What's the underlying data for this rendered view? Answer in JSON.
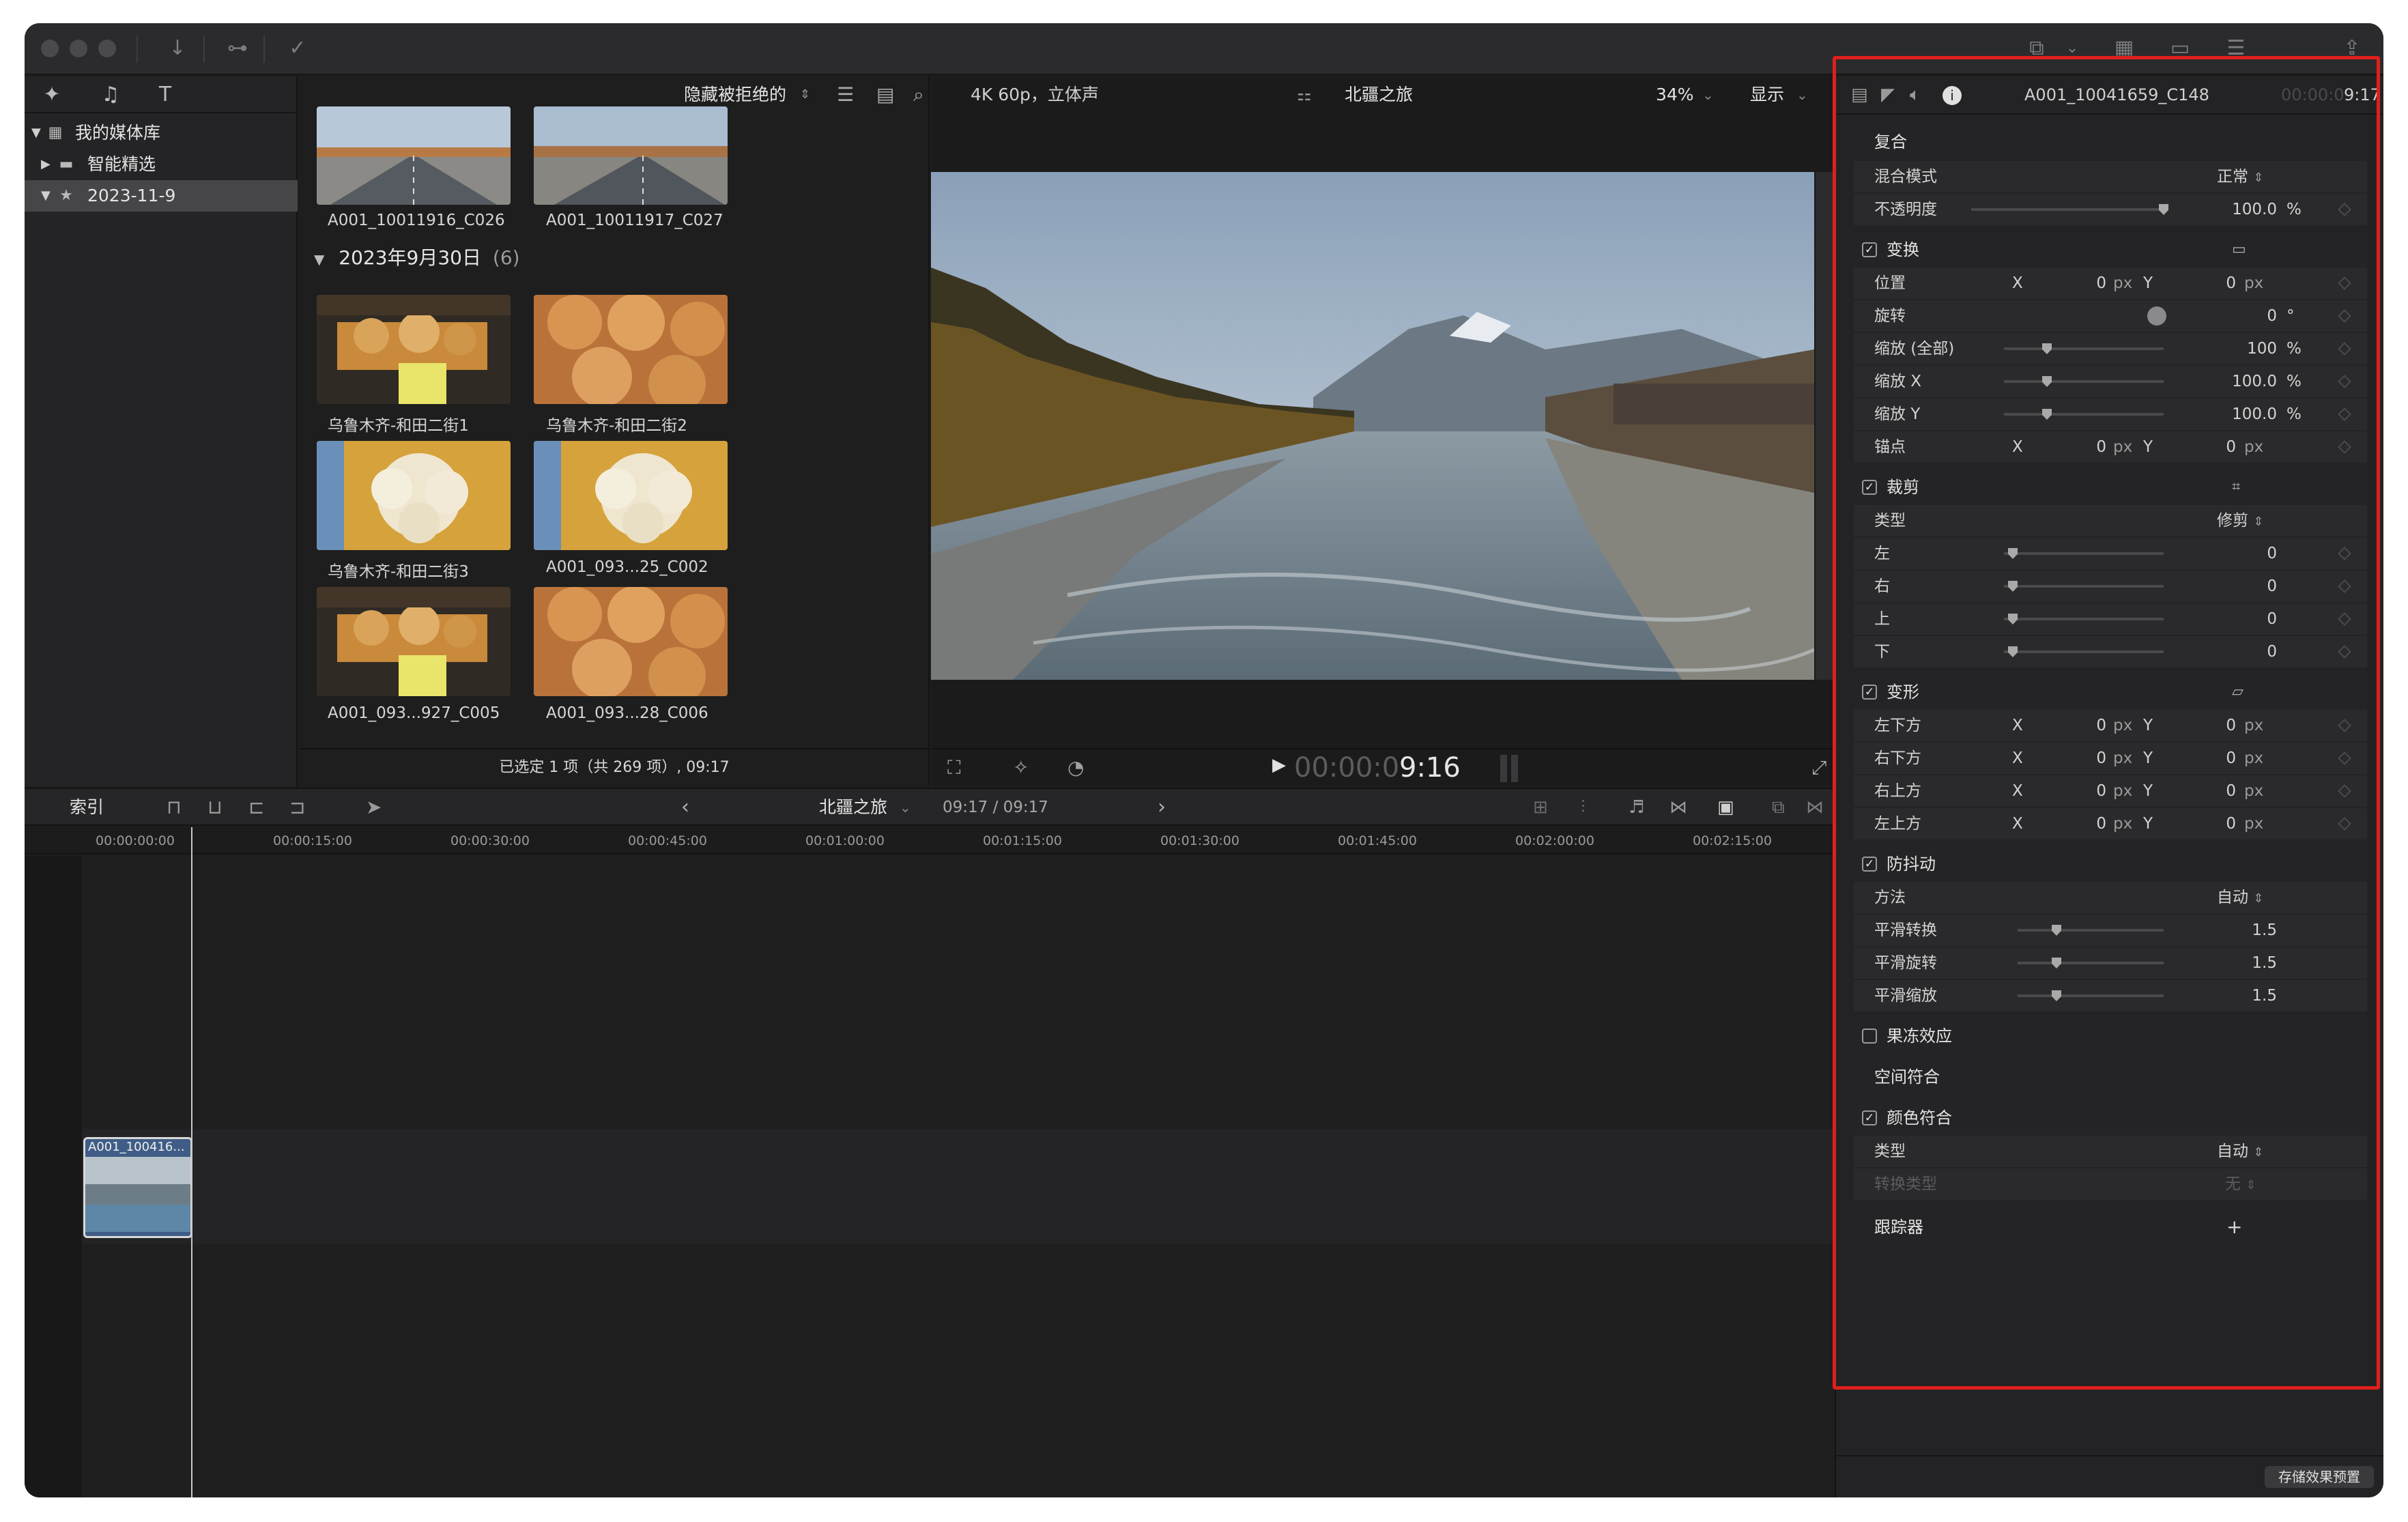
{
  "library": {
    "items": [
      {
        "label": "我的媒体库",
        "icon": "library-grid-icon"
      },
      {
        "label": "智能精选",
        "icon": "folder-icon"
      },
      {
        "label": "2023-11-9",
        "icon": "event-star-icon"
      }
    ]
  },
  "browser": {
    "filter": "隐藏被拒绝的",
    "date_group": "2023年9月30日",
    "date_group_count": "(6)",
    "clips": [
      {
        "name": "A001_10011916_C026",
        "style": "road"
      },
      {
        "name": "A001_10011917_C027",
        "style": "road"
      },
      {
        "name": "乌鲁木齐-和田二街1",
        "style": "stall"
      },
      {
        "name": "乌鲁木齐-和田二街2",
        "style": "bread"
      },
      {
        "name": "乌鲁木齐-和田二街3",
        "style": "cauli"
      },
      {
        "name": "A001_093...25_C002",
        "style": "cauli"
      },
      {
        "name": "A001_093...927_C005",
        "style": "stall"
      },
      {
        "name": "A001_093...28_C006",
        "style": "bread"
      }
    ],
    "status": "已选定 1 项（共 269 项）, 09:17"
  },
  "viewer": {
    "format": "4K 60p，立体声",
    "project": "北疆之旅",
    "zoom": "34%",
    "display": "显示",
    "timecode_dim": "00:00:0",
    "timecode_bright": "9:16"
  },
  "timeline": {
    "index_label": "索引",
    "project": "北疆之旅",
    "duration": "09:17 / 09:17",
    "ruler": [
      "00:00:00:00",
      "00:00:15:00",
      "00:00:30:00",
      "00:00:45:00",
      "00:01:00:00",
      "00:01:15:00",
      "00:01:30:00",
      "00:01:45:00",
      "00:02:00:00",
      "00:02:15:00"
    ],
    "clip_label": "A001_100416..."
  },
  "inspector": {
    "clip_name": "A001_10041659_C148",
    "duration_dim": "00:00:0",
    "duration_bright": "9:17",
    "sections": {
      "composite": "复合",
      "blend_mode_label": "混合模式",
      "blend_mode_value": "正常",
      "opacity_label": "不透明度",
      "opacity_value": "100.0",
      "opacity_unit": "%",
      "opacity_level": 1.0,
      "transform": "变换",
      "position_label": "位置",
      "rotation_label": "旋转",
      "rotation_value": "0",
      "rotation_unit": "°",
      "scale_all_label": "缩放 (全部)",
      "scale_all_value": "100",
      "scale_x_label": "缩放 X",
      "scale_x_value": "100.0",
      "scale_y_label": "缩放 Y",
      "scale_y_value": "100.0",
      "anchor_label": "锚点",
      "crop": "裁剪",
      "crop_type_label": "类型",
      "crop_type_value": "修剪",
      "left_label": "左",
      "right_label": "右",
      "top_label": "上",
      "bottom_label": "下",
      "distort": "变形",
      "bottom_left_label": "左下方",
      "bottom_right_label": "右下方",
      "top_right_label": "右上方",
      "top_left_label": "左上方",
      "stabilization": "防抖动",
      "method_label": "方法",
      "method_value": "自动",
      "smooth_translate_label": "平滑转换",
      "smooth_rotate_label": "平滑旋转",
      "smooth_scale_label": "平滑缩放",
      "smooth_value": "1.5",
      "rolling_shutter": "果冻效应",
      "spatial_conform": "空间符合",
      "color_conform": "颜色符合",
      "color_type_label": "类型",
      "color_type_value": "自动",
      "convert_type_label": "转换类型",
      "convert_type_value": "无",
      "tracker": "跟踪器",
      "add_symbol": "+",
      "x": "X",
      "y": "Y",
      "zero": "0",
      "px": "px",
      "pct": "%"
    },
    "save_preset": "存储效果预置"
  },
  "colors": {
    "highlight_box": "#e0201b",
    "clip_border": "#5a8fd8"
  }
}
